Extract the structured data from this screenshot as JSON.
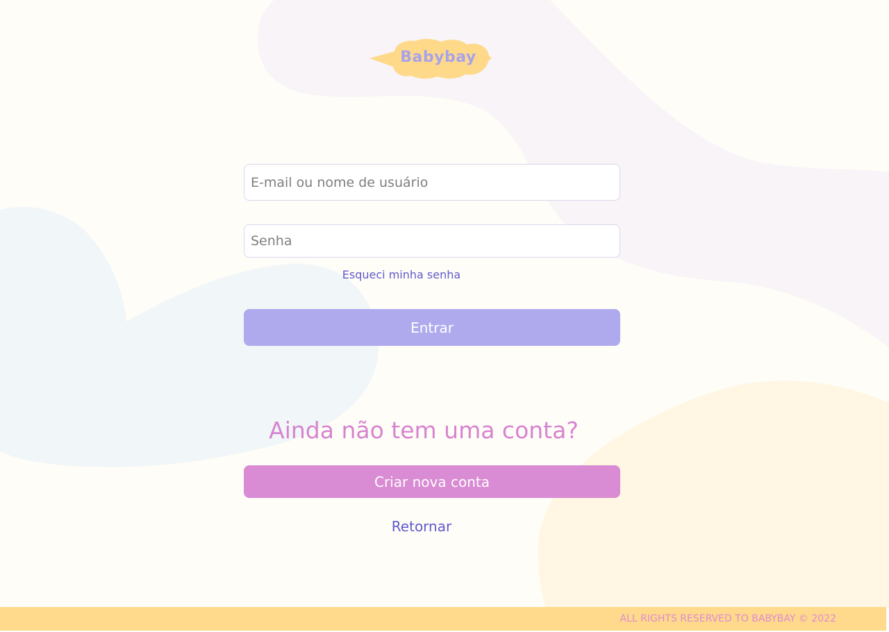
{
  "logo": {
    "text": "Babybay"
  },
  "login": {
    "email_placeholder": "E-mail ou nome de usuário",
    "password_placeholder": "Senha",
    "forgot_password": "Esqueci minha senha",
    "submit_label": "Entrar"
  },
  "signup": {
    "heading": "Ainda não tem uma conta?",
    "button_label": "Criar nova conta"
  },
  "back_link": "Retornar",
  "footer": {
    "text": "ALL RIGHTS RESERVED TO BABYBAY © 2022"
  },
  "colors": {
    "background": "#FFFDF8",
    "primary_button": "#AFAAEE",
    "secondary_button": "#D98BD3",
    "link": "#5F5ACB",
    "heading": "#D784CF",
    "footer_bar": "#FFDA8C",
    "logo_bubble": "#FFD98A",
    "logo_text": "#A8A3E8"
  }
}
